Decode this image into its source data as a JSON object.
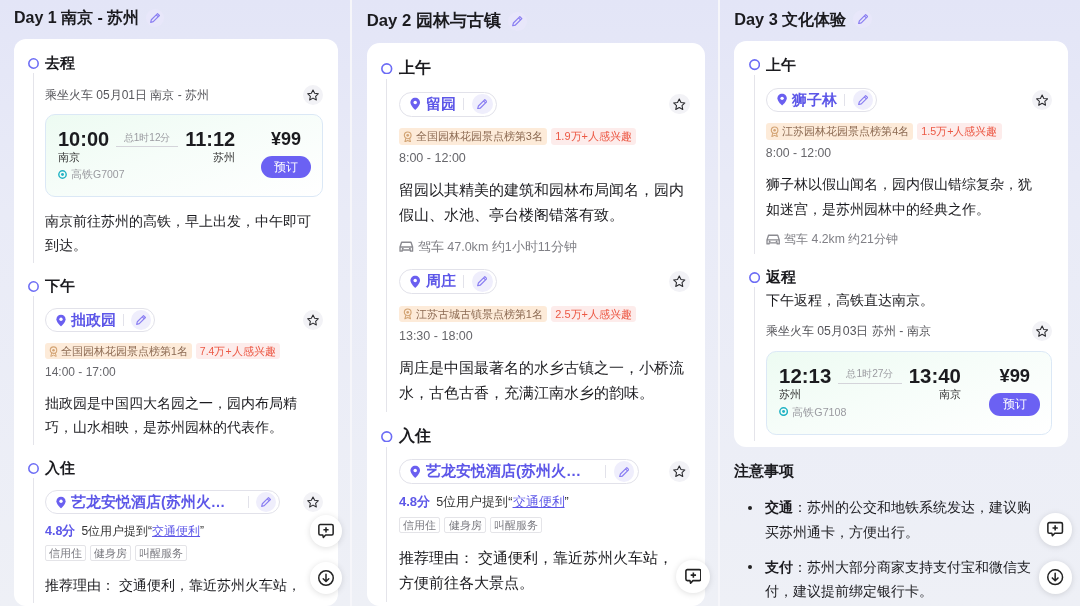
{
  "days": [
    {
      "title": "Day 1 南京 - 苏州",
      "sections": [
        {
          "heading": "去程",
          "items": [
            {
              "kind": "train",
              "route": "乘坐火车 05月01日 南京 - 苏州",
              "depart_time": "10:00",
              "duration": "总1时12分",
              "arrive_time": "11:12",
              "depart_station": "南京",
              "arrive_station": "苏州",
              "train_number": "高铁G7007",
              "price": "¥99",
              "book_label": "预订"
            },
            {
              "kind": "text",
              "text": "南京前往苏州的高铁，早上出发，中午即可到达。"
            }
          ]
        },
        {
          "heading": "下午",
          "items": [
            {
              "kind": "place",
              "name": "拙政园",
              "rank": "全国园林花园景点榜第1名",
              "popularity": "7.4万+人感兴趣",
              "hours": "14:00 - 17:00",
              "description": "拙政园是中国四大名园之一，园内布局精巧，山水相映，是苏州园林的代表作。"
            }
          ]
        },
        {
          "heading": "入住",
          "items": [
            {
              "kind": "hotel",
              "name": "艺龙安悦酒店(苏州火…",
              "score": "4.8分",
              "mention_before": "5位用户提到“",
              "mention_link": "交通便利",
              "mention_after": "”",
              "tags": [
                "信用住",
                "健身房",
                "叫醒服务"
              ],
              "reason": "推荐理由： 交通便利，靠近苏州火车站，"
            }
          ]
        }
      ],
      "float_buttons": [
        {
          "kind": "comment"
        },
        {
          "kind": "download"
        }
      ]
    },
    {
      "title": "Day 2 园林与古镇",
      "sections": [
        {
          "heading": "上午",
          "items": [
            {
              "kind": "place",
              "name": "留园",
              "rank": "全国园林花园景点榜第3名",
              "popularity": "1.9万+人感兴趣",
              "hours": "8:00 - 12:00",
              "description": "留园以其精美的建筑和园林布局闻名，园内假山、水池、亭台楼阁错落有致。",
              "drive": "驾车 47.0km 约1小时11分钟"
            },
            {
              "kind": "place",
              "name": "周庄",
              "rank": "江苏古城古镇景点榜第1名",
              "popularity": "2.5万+人感兴趣",
              "hours": "13:30 - 18:00",
              "description": "周庄是中国最著名的水乡古镇之一，小桥流水，古色古香，充满江南水乡的韵味。"
            }
          ]
        },
        {
          "heading": "入住",
          "items": [
            {
              "kind": "hotel",
              "name": "艺龙安悦酒店(苏州火…",
              "score": "4.8分",
              "mention_before": "5位用户提到“",
              "mention_link": "交通便利",
              "mention_after": "”",
              "tags": [
                "信用住",
                "健身房",
                "叫醒服务"
              ],
              "reason": "推荐理由： 交通便利，靠近苏州火车站，方便前往各大景点。"
            }
          ]
        }
      ],
      "float_buttons": [
        {
          "kind": "comment"
        }
      ]
    },
    {
      "title": "Day 3 文化体验",
      "sections": [
        {
          "heading": "上午",
          "items": [
            {
              "kind": "place",
              "name": "狮子林",
              "rank": "江苏园林花园景点榜第4名",
              "popularity": "1.5万+人感兴趣",
              "hours": "8:00 - 12:00",
              "description": "狮子林以假山闻名，园内假山错综复杂，犹如迷宫，是苏州园林中的经典之作。",
              "drive": "驾车 4.2km 约21分钟"
            }
          ]
        },
        {
          "heading": "返程",
          "items": [
            {
              "kind": "text",
              "text": "下午返程，高铁直达南京。"
            },
            {
              "kind": "train",
              "route": "乘坐火车 05月03日 苏州 - 南京",
              "depart_time": "12:13",
              "duration": "总1时27分",
              "arrive_time": "13:40",
              "depart_station": "苏州",
              "arrive_station": "南京",
              "train_number": "高铁G7108",
              "price": "¥99",
              "book_label": "预订"
            }
          ]
        }
      ],
      "notes": {
        "heading": "注意事项",
        "items": [
          "**交通**：苏州的公交和地铁系统发达，建议购买苏州通卡，方便出行。",
          "**支付**：苏州大部分商家支持支付宝和微信支付，建议提前绑定银行卡。"
        ]
      },
      "float_buttons": [
        {
          "kind": "comment"
        },
        {
          "kind": "download"
        }
      ]
    }
  ]
}
